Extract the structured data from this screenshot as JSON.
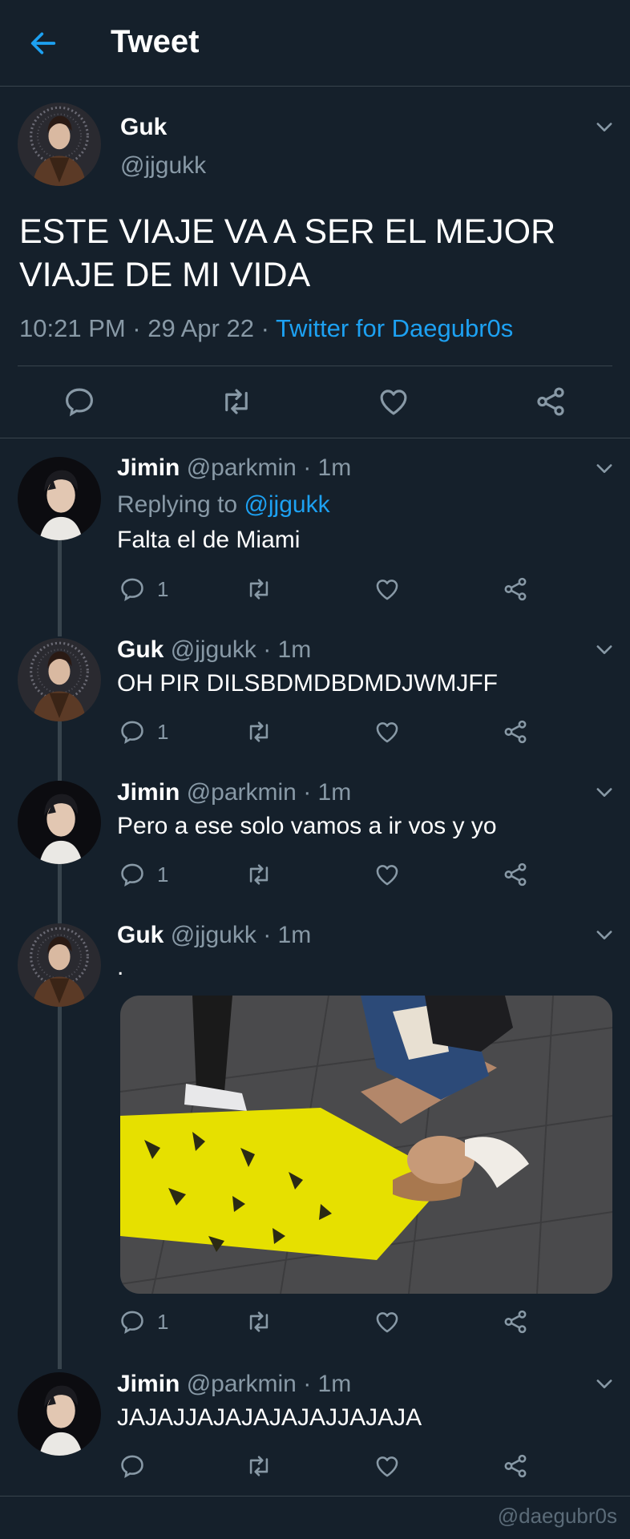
{
  "header": {
    "title": "Tweet"
  },
  "main_tweet": {
    "name": "Guk",
    "handle": "@jjgukk",
    "text": "ESTE VIAJE VA A SER EL MEJOR VIAJE DE MI VIDA",
    "meta": "10:21 PM · 29 Apr 22 · ",
    "source": "Twitter for Daegubr0s"
  },
  "replies": [
    {
      "name": "Jimin",
      "handle_time": "@parkmin · 1m",
      "replying_label": "Replying to ",
      "replying_to": "@jjgukk",
      "text": "Falta el de Miami",
      "reply_count": "1"
    },
    {
      "name": "Guk",
      "handle_time": "@jjgukk · 1m",
      "text": "OH PIR DILSBDMDBDMDJWMJFF",
      "reply_count": "1"
    },
    {
      "name": "Jimin",
      "handle_time": "@parkmin · 1m",
      "text": "Pero a ese solo vamos a ir vos y yo",
      "reply_count": "1"
    },
    {
      "name": "Guk",
      "handle_time": "@jjgukk · 1m",
      "text": ".",
      "reply_count": "1"
    },
    {
      "name": "Jimin",
      "handle_time": "@parkmin · 1m",
      "text": "JAJAJJAJAJAJAJAJJAJAJA"
    }
  ],
  "watermark": "@daegubr0s",
  "colors": {
    "background": "#15202b",
    "accent": "#1da1f2",
    "muted": "#8899a6",
    "divider": "#38444d"
  }
}
